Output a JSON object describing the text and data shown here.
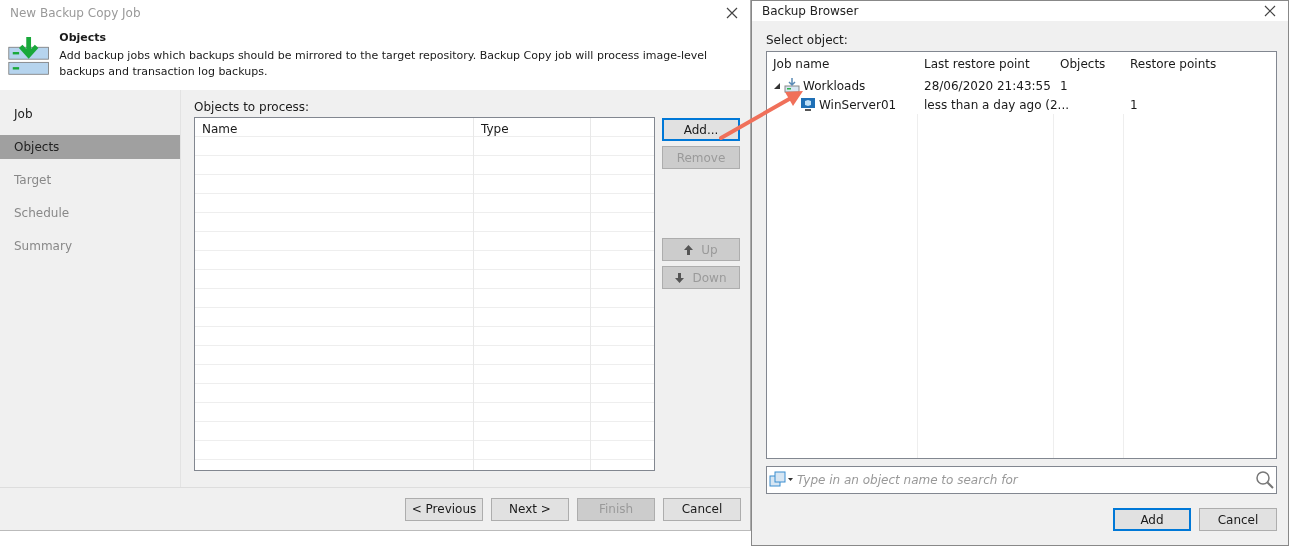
{
  "wizard": {
    "title": "New Backup Copy Job",
    "header": {
      "title": "Objects",
      "description": "Add backup jobs which backups should be mirrored to the target repository. Backup Copy job will process image-level backups and transaction log backups."
    },
    "steps": [
      {
        "label": "Job",
        "selected": false,
        "disabled": false
      },
      {
        "label": "Objects",
        "selected": true,
        "disabled": false
      },
      {
        "label": "Target",
        "selected": false,
        "disabled": true
      },
      {
        "label": "Schedule",
        "selected": false,
        "disabled": true
      },
      {
        "label": "Summary",
        "selected": false,
        "disabled": true
      }
    ],
    "objects_label": "Objects to process:",
    "table": {
      "columns": [
        "Name",
        "Type"
      ]
    },
    "side_buttons": [
      {
        "label": "Add...",
        "disabled": false,
        "focused": true,
        "kind": "plain"
      },
      {
        "label": "Remove",
        "disabled": true,
        "focused": false,
        "kind": "plain"
      },
      {
        "label": "Up",
        "disabled": true,
        "focused": false,
        "kind": "up"
      },
      {
        "label": "Down",
        "disabled": true,
        "focused": false,
        "kind": "down"
      }
    ],
    "footer_buttons": [
      {
        "label": "< Previous",
        "disabled": false
      },
      {
        "label": "Next >",
        "disabled": false
      },
      {
        "label": "Finish",
        "disabled": true
      },
      {
        "label": "Cancel",
        "disabled": false
      }
    ]
  },
  "browser": {
    "title": "Backup Browser",
    "select_label": "Select object:",
    "columns": [
      "Job name",
      "Last restore point",
      "Objects",
      "Restore points"
    ],
    "tree": [
      {
        "name": "Workloads",
        "kind": "job",
        "expanded": true,
        "last_restore_point": "28/06/2020 21:43:55",
        "objects": "1",
        "children": [
          {
            "name": "WinServer01",
            "kind": "vm",
            "last_restore_point": "less than a day ago (2...",
            "restore_points": "1"
          }
        ]
      }
    ],
    "search": {
      "placeholder": "Type in an object name to search for"
    },
    "buttons": [
      {
        "label": "Add",
        "default": true
      },
      {
        "label": "Cancel",
        "default": false
      }
    ]
  }
}
